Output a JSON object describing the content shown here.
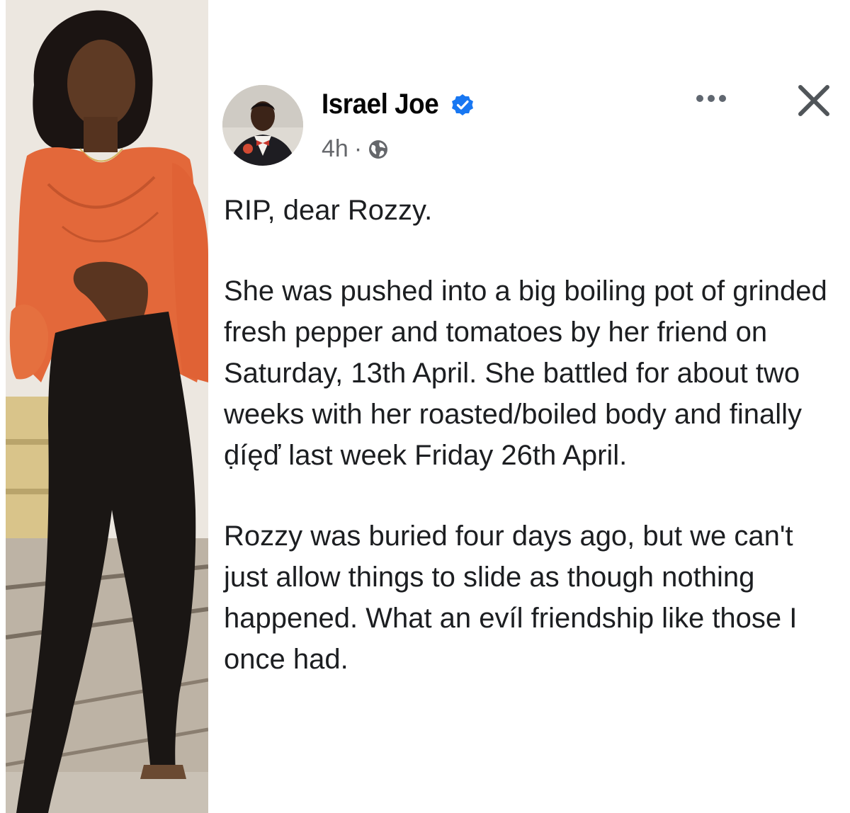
{
  "post": {
    "author": {
      "name": "Israel Joe",
      "verified": true
    },
    "meta": {
      "time": "4h",
      "separator": "·",
      "audience_icon": "globe-icon"
    },
    "actions": {
      "more_icon": "more-horizontal-icon",
      "close_icon": "close-icon"
    },
    "paragraphs": [
      "RIP, dear Rozzy.",
      "She was pushed into a big boiling pot of grinded fresh pepper and tomatoes by her friend on Saturday, 13th April. She battled for about two weeks with her roasted/boiled body and finally ḍíęď last week Friday 26th April.",
      "Rozzy was buried four days ago, but we can't just allow things to slide as though nothing happened. What an evíl friendship like those I once had."
    ]
  },
  "colors": {
    "verified_badge": "#1877f2",
    "meta_text": "#65676b",
    "body_text": "#1c1e21"
  }
}
